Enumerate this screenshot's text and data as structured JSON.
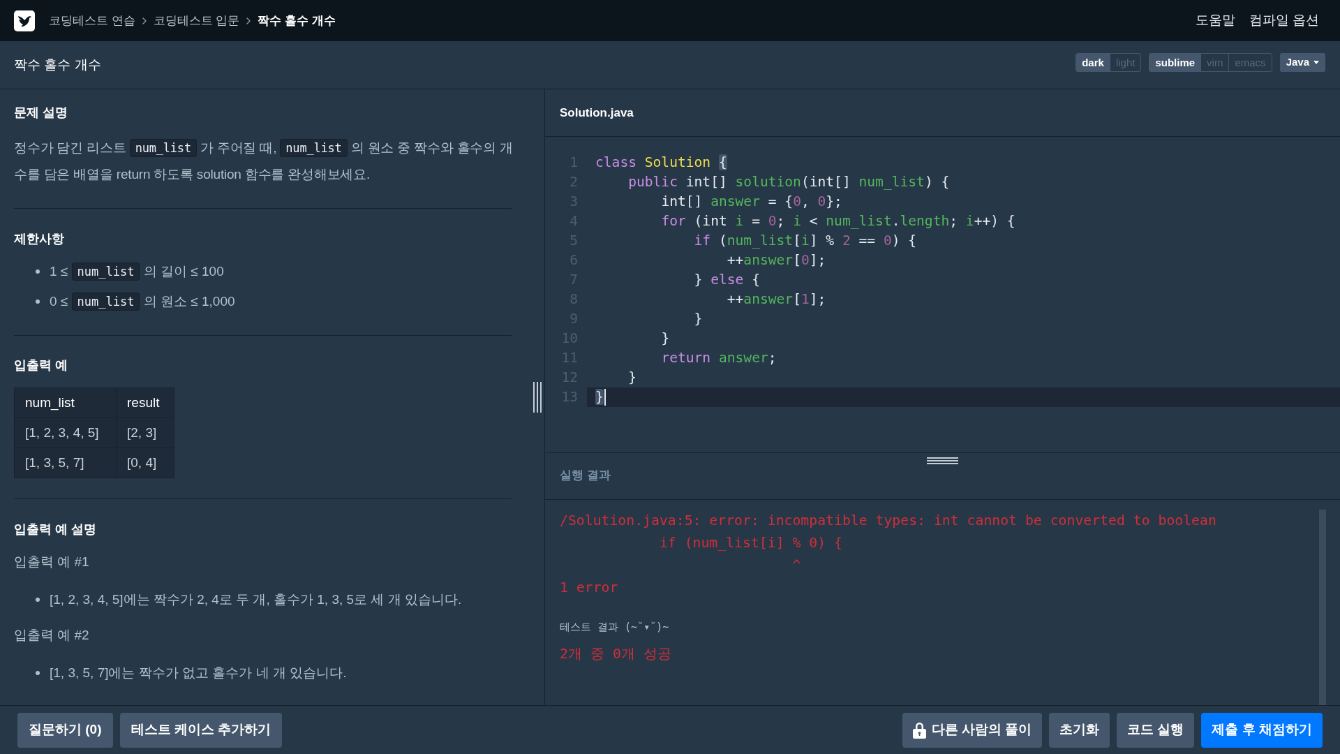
{
  "nav": {
    "breadcrumbs": [
      "코딩테스트 연습",
      "코딩테스트 입문",
      "짝수 홀수 개수"
    ],
    "links": [
      "도움말",
      "컴파일 옵션"
    ]
  },
  "title_bar": {
    "title": "짝수 홀수 개수",
    "theme_options": [
      {
        "label": "dark",
        "selected": true
      },
      {
        "label": "light",
        "selected": false
      }
    ],
    "keymap_options": [
      {
        "label": "sublime",
        "selected": true
      },
      {
        "label": "vim",
        "selected": false
      },
      {
        "label": "emacs",
        "selected": false
      }
    ],
    "language": "Java"
  },
  "problem": {
    "description": {
      "heading": "문제 설명",
      "paragraph": [
        {
          "kind": "text",
          "text": "정수가 담긴 리스트 "
        },
        {
          "kind": "code",
          "text": "num_list"
        },
        {
          "kind": "text",
          "text": " 가 주어질 때, "
        },
        {
          "kind": "code",
          "text": "num_list"
        },
        {
          "kind": "text",
          "text": " 의 원소 중 짝수와 홀수의 개수를 담은 배열을 return 하도록 solution 함수를 완성해보세요."
        }
      ]
    },
    "constraints": {
      "heading": "제한사항",
      "items": [
        [
          {
            "kind": "text",
            "text": "1 ≤ "
          },
          {
            "kind": "code",
            "text": "num_list"
          },
          {
            "kind": "text",
            "text": " 의 길이 ≤ 100"
          }
        ],
        [
          {
            "kind": "text",
            "text": "0 ≤ "
          },
          {
            "kind": "code",
            "text": "num_list"
          },
          {
            "kind": "text",
            "text": " 의 원소 ≤ 1,000"
          }
        ]
      ]
    },
    "examples": {
      "heading": "입출력 예",
      "table": {
        "columns": [
          "num_list",
          "result"
        ],
        "rows": [
          [
            "[1, 2, 3, 4, 5]",
            "[2, 3]"
          ],
          [
            "[1, 3, 5, 7]",
            "[0, 4]"
          ]
        ]
      }
    },
    "explanation": {
      "heading": "입출력 예 설명",
      "cases": [
        {
          "title": "입출력 예 #1",
          "items": [
            "[1, 2, 3, 4, 5]에는 짝수가 2, 4로 두 개, 홀수가 1, 3, 5로 세 개 있습니다."
          ]
        },
        {
          "title": "입출력 예 #2",
          "items": [
            "[1, 3, 5, 7]에는 짝수가 없고 홀수가 네 개 있습니다."
          ]
        }
      ]
    }
  },
  "editor": {
    "filename": "Solution.java",
    "lines": [
      {
        "number": "1",
        "active": false,
        "tokens": [
          {
            "kind": "keyword",
            "text": "class"
          },
          {
            "kind": "class",
            "text": " Solution "
          },
          {
            "kind": "brace",
            "text": "{"
          }
        ]
      },
      {
        "number": "2",
        "active": false,
        "tokens": [
          {
            "kind": "keyword",
            "text": "    public"
          },
          {
            "kind": "plain",
            "text": " int[] "
          },
          {
            "kind": "name",
            "text": "solution"
          },
          {
            "kind": "plain",
            "text": "(int[] "
          },
          {
            "kind": "name",
            "text": "num_list"
          },
          {
            "kind": "plain",
            "text": ") {"
          }
        ]
      },
      {
        "number": "3",
        "active": false,
        "tokens": [
          {
            "kind": "plain",
            "text": "        int[] "
          },
          {
            "kind": "name",
            "text": "answer"
          },
          {
            "kind": "plain",
            "text": " = {"
          },
          {
            "kind": "number",
            "text": "0"
          },
          {
            "kind": "plain",
            "text": ", "
          },
          {
            "kind": "number",
            "text": "0"
          },
          {
            "kind": "plain",
            "text": "};"
          }
        ]
      },
      {
        "number": "4",
        "active": false,
        "tokens": [
          {
            "kind": "keyword",
            "text": "        for"
          },
          {
            "kind": "plain",
            "text": " (int "
          },
          {
            "kind": "name",
            "text": "i"
          },
          {
            "kind": "plain",
            "text": " = "
          },
          {
            "kind": "number",
            "text": "0"
          },
          {
            "kind": "plain",
            "text": "; "
          },
          {
            "kind": "name",
            "text": "i"
          },
          {
            "kind": "plain",
            "text": " < "
          },
          {
            "kind": "name",
            "text": "num_list"
          },
          {
            "kind": "plain",
            "text": "."
          },
          {
            "kind": "name",
            "text": "length"
          },
          {
            "kind": "plain",
            "text": "; "
          },
          {
            "kind": "name",
            "text": "i"
          },
          {
            "kind": "plain",
            "text": "++) {"
          }
        ]
      },
      {
        "number": "5",
        "active": false,
        "tokens": [
          {
            "kind": "keyword",
            "text": "            if"
          },
          {
            "kind": "plain",
            "text": " ("
          },
          {
            "kind": "name",
            "text": "num_list"
          },
          {
            "kind": "plain",
            "text": "["
          },
          {
            "kind": "name",
            "text": "i"
          },
          {
            "kind": "plain",
            "text": "] % "
          },
          {
            "kind": "number",
            "text": "2"
          },
          {
            "kind": "plain",
            "text": " == "
          },
          {
            "kind": "number",
            "text": "0"
          },
          {
            "kind": "plain",
            "text": ") {"
          }
        ]
      },
      {
        "number": "6",
        "active": false,
        "tokens": [
          {
            "kind": "plain",
            "text": "                ++"
          },
          {
            "kind": "name",
            "text": "answer"
          },
          {
            "kind": "plain",
            "text": "["
          },
          {
            "kind": "number",
            "text": "0"
          },
          {
            "kind": "plain",
            "text": "];"
          }
        ]
      },
      {
        "number": "7",
        "active": false,
        "tokens": [
          {
            "kind": "plain",
            "text": "            } "
          },
          {
            "kind": "keyword",
            "text": "else"
          },
          {
            "kind": "plain",
            "text": " {"
          }
        ]
      },
      {
        "number": "8",
        "active": false,
        "tokens": [
          {
            "kind": "plain",
            "text": "                ++"
          },
          {
            "kind": "name",
            "text": "answer"
          },
          {
            "kind": "plain",
            "text": "["
          },
          {
            "kind": "number",
            "text": "1"
          },
          {
            "kind": "plain",
            "text": "];"
          }
        ]
      },
      {
        "number": "9",
        "active": false,
        "tokens": [
          {
            "kind": "plain",
            "text": "            }"
          }
        ]
      },
      {
        "number": "10",
        "active": false,
        "tokens": [
          {
            "kind": "plain",
            "text": "        }"
          }
        ]
      },
      {
        "number": "11",
        "active": false,
        "tokens": [
          {
            "kind": "keyword",
            "text": "        return"
          },
          {
            "kind": "name",
            "text": " answer"
          },
          {
            "kind": "plain",
            "text": ";"
          }
        ]
      },
      {
        "number": "12",
        "active": false,
        "tokens": [
          {
            "kind": "plain",
            "text": "    }"
          }
        ]
      },
      {
        "number": "13",
        "active": true,
        "tokens": [
          {
            "kind": "brace",
            "text": "}"
          }
        ]
      }
    ]
  },
  "result": {
    "heading": "실행 결과",
    "error_output": "/Solution.java:5: error: incompatible types: int cannot be converted to boolean\n            if (num_list[i] % 0) {\n                            ^\n1 error",
    "test_heading": "테스트 결과 (~˘▾˘)~",
    "summary": "2개 중 0개 성공"
  },
  "footer": {
    "left_buttons": [
      "질문하기 (0)",
      "테스트 케이스 추가하기"
    ],
    "right_buttons": [
      {
        "label": "다른 사람의 풀이",
        "kind": "locked"
      },
      {
        "label": "초기화",
        "kind": "secondary"
      },
      {
        "label": "코드 실행",
        "kind": "secondary"
      },
      {
        "label": "제출 후 채점하기",
        "kind": "primary"
      }
    ]
  }
}
